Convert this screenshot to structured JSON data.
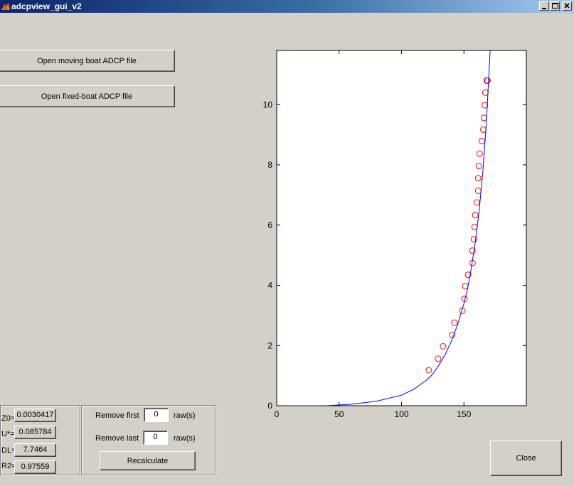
{
  "window": {
    "title": "adcpview_gui_v2"
  },
  "buttons": {
    "open_moving": "Open moving boat ADCP file",
    "open_fixed": "Open fixed-boat ADCP file",
    "recalculate": "Recalculate",
    "close": "Close"
  },
  "results": [
    {
      "label": "Z0=",
      "value": "0.0030417"
    },
    {
      "label": "U*=",
      "value": "0.085784"
    },
    {
      "label": "DL=",
      "value": "7.7464"
    },
    {
      "label": "R2=",
      "value": "0.97559"
    }
  ],
  "trim": {
    "first_label": "Remove first",
    "first_value": "0",
    "last_label": "Remove last",
    "last_value": "0",
    "unit": "raw(s)"
  },
  "chart_data": {
    "type": "scatter",
    "title": "",
    "xlabel": "",
    "ylabel": "",
    "xlim": [
      0,
      200
    ],
    "ylim": [
      0,
      11.8
    ],
    "xticks": [
      "0",
      "50",
      "100",
      "150"
    ],
    "yticks": [
      "0",
      "2",
      "4",
      "6",
      "8",
      "10"
    ],
    "xtick_values": [
      0,
      50,
      100,
      150
    ],
    "ytick_values": [
      0,
      2,
      4,
      6,
      8,
      10
    ],
    "grid": false,
    "legend": "none",
    "series": [
      {
        "kind": "markers",
        "marker": "circle",
        "color": "#ff0000",
        "x": [
          121.9,
          129.3,
          133.3,
          140.7,
          142.4,
          148.7,
          150.4,
          151.0,
          153.4,
          156.8,
          156.8,
          158.0,
          158.5,
          159.1,
          160.3,
          161.4,
          161.4,
          162.0,
          162.6,
          164.4,
          165.5,
          166.1,
          166.7,
          167.2,
          168.4,
          168.4,
          168.9
        ],
        "y": [
          1.18,
          1.56,
          1.97,
          2.35,
          2.76,
          3.15,
          3.55,
          3.97,
          4.35,
          4.74,
          5.15,
          5.53,
          5.94,
          6.33,
          6.75,
          7.14,
          7.56,
          7.96,
          8.37,
          8.79,
          9.17,
          9.56,
          9.98,
          10.4,
          10.8,
          10.8,
          10.8
        ]
      },
      {
        "kind": "line",
        "color": "#0000ff",
        "x": [
          0,
          40,
          60,
          80,
          100,
          110,
          120,
          125,
          130,
          135,
          140,
          145,
          150,
          153,
          156,
          159,
          162,
          165,
          168,
          171
        ],
        "y": [
          0,
          0,
          0.05,
          0.15,
          0.35,
          0.55,
          0.85,
          1.05,
          1.35,
          1.7,
          2.15,
          2.7,
          3.4,
          3.9,
          4.6,
          5.4,
          6.4,
          7.7,
          9.4,
          11.8
        ]
      }
    ]
  }
}
